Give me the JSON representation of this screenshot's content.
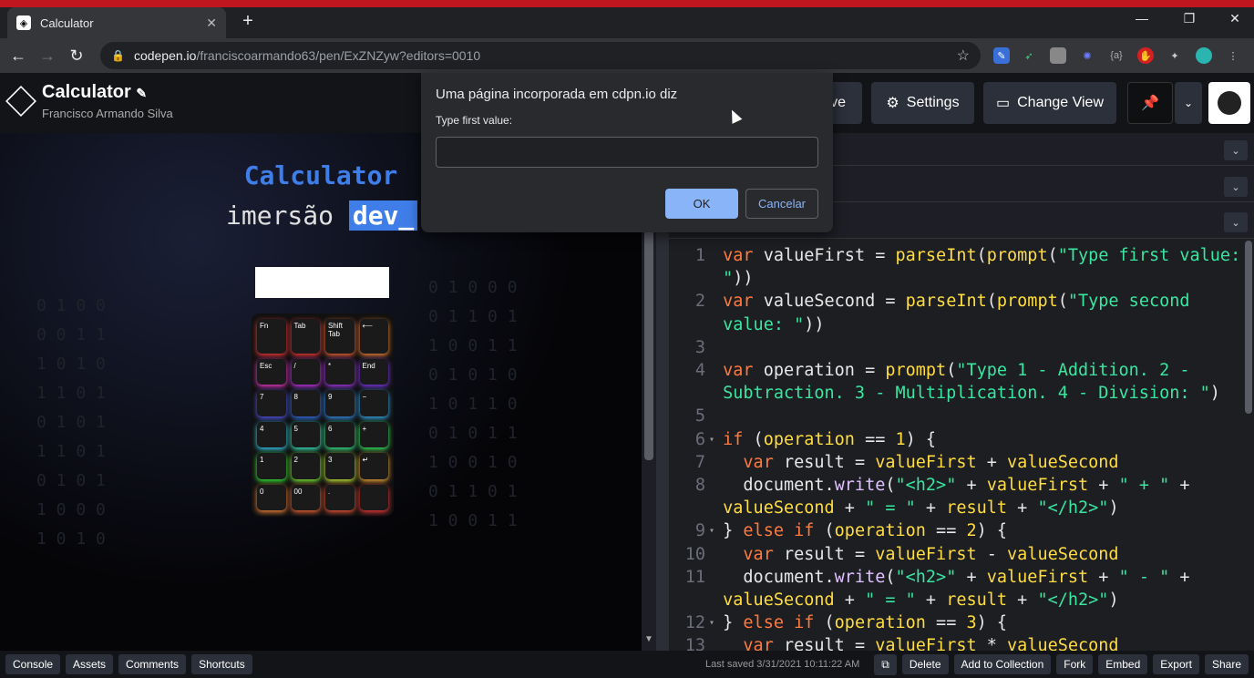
{
  "browser": {
    "tab_title": "Calculator",
    "url_host": "codepen.io",
    "url_path": "/franciscoarmando63/pen/ExZNZyw?editors=0010",
    "new_tab": "+",
    "close_tab": "✕",
    "win_min": "—",
    "win_max": "❐",
    "win_close": "✕"
  },
  "codepen": {
    "pen_title": "Calculator",
    "author": "Francisco Armando Silva",
    "save_label": "ve",
    "settings_label": "Settings",
    "change_view_label": "Change View"
  },
  "preview": {
    "title": "Calculator",
    "subtitle_plain": "imersão ",
    "subtitle_highlight": "dev_",
    "matrix_left": "0 1 0 0\n0 0 1 1\n1 0 1 0\n1 1 0 1\n0 1 0 1\n1 1 0 1\n0 1 0 1\n1 0 0 0\n1 0 1 0",
    "matrix_right": "0 1 0 0 0\n0 1 1 0 1\n1 0 0 1 1\n0 1 0 1 0\n1 0 1 1 0\n0 1 0 1 1\n1 0 0 1 0\n0 1 1 0 1\n1 0 0 1 1",
    "keys": [
      "Fn",
      "Tab",
      "Shift Tab",
      "⟵",
      "Esc",
      "/",
      "*",
      "End",
      "7",
      "8",
      "9",
      "−",
      "4",
      "5",
      "6",
      "+",
      "1",
      "2",
      "3",
      "↵",
      "0",
      "00",
      ".",
      ""
    ]
  },
  "dialog": {
    "title": "Uma página incorporada em cdpn.io diz",
    "label": "Type first value:",
    "input_value": "",
    "ok_label": "OK",
    "cancel_label": "Cancelar"
  },
  "code": {
    "lines": [
      {
        "n": "1",
        "fold": "",
        "html": "<span class='kw'>var</span> valueFirst = <span class='fn'>parseInt</span>(<span class='fn'>prompt</span>(<span class='str'>\"Type first value:</span>"
      },
      {
        "n": "",
        "fold": "",
        "html": "<span class='str'>\"</span>))"
      },
      {
        "n": "2",
        "fold": "",
        "html": "<span class='kw'>var</span> valueSecond = <span class='fn'>parseInt</span>(<span class='fn'>prompt</span>(<span class='str'>\"Type second</span>"
      },
      {
        "n": "",
        "fold": "",
        "html": "<span class='str'>value: \"</span>))"
      },
      {
        "n": "3",
        "fold": "",
        "html": ""
      },
      {
        "n": "4",
        "fold": "",
        "html": "<span class='kw'>var</span> operation = <span class='fn'>prompt</span>(<span class='str'>\"Type 1 - Addition. 2 -</span>"
      },
      {
        "n": "",
        "fold": "",
        "html": "<span class='str'>Subtraction. 3 - Multiplication. 4 - Division: \"</span>)"
      },
      {
        "n": "5",
        "fold": "",
        "html": ""
      },
      {
        "n": "6",
        "fold": "▾",
        "html": "<span class='kw'>if</span> (<span class='fn'>operation</span> == <span class='fn'>1</span>) {"
      },
      {
        "n": "7",
        "fold": "",
        "html": "  <span class='kw'>var</span> result = <span class='fn'>valueFirst</span> + <span class='fn'>valueSecond</span>"
      },
      {
        "n": "8",
        "fold": "",
        "html": "  document.<span class='vn'>write</span>(<span class='str'>\"&lt;h2&gt;\"</span> + <span class='fn'>valueFirst</span> + <span class='str'>\" + \"</span> +"
      },
      {
        "n": "",
        "fold": "",
        "html": "<span class='fn'>valueSecond</span> + <span class='str'>\" = \"</span> + <span class='fn'>result</span> + <span class='str'>\"&lt;/h2&gt;\"</span>)"
      },
      {
        "n": "9",
        "fold": "▾",
        "html": "} <span class='kw'>else if</span> (<span class='fn'>operation</span> == <span class='fn'>2</span>) {"
      },
      {
        "n": "10",
        "fold": "",
        "html": "  <span class='kw'>var</span> result = <span class='fn'>valueFirst</span> - <span class='fn'>valueSecond</span>"
      },
      {
        "n": "11",
        "fold": "",
        "html": "  document.<span class='vn'>write</span>(<span class='str'>\"&lt;h2&gt;\"</span> + <span class='fn'>valueFirst</span> + <span class='str'>\" - \"</span> +"
      },
      {
        "n": "",
        "fold": "",
        "html": "<span class='fn'>valueSecond</span> + <span class='str'>\" = \"</span> + <span class='fn'>result</span> + <span class='str'>\"&lt;/h2&gt;\"</span>)"
      },
      {
        "n": "12",
        "fold": "▾",
        "html": "} <span class='kw'>else if</span> (<span class='fn'>operation</span> == <span class='fn'>3</span>) {"
      },
      {
        "n": "13",
        "fold": "",
        "html": "  <span class='kw'>var</span> result = <span class='fn'>valueFirst</span> * <span class='fn'>valueSecond</span>"
      }
    ]
  },
  "footer": {
    "buttons_left": [
      "Console",
      "Assets",
      "Comments",
      "Shortcuts"
    ],
    "last_saved": "Last saved 3/31/2021 10:11:22 AM",
    "buttons_right": [
      "Delete",
      "Add to Collection",
      "Fork",
      "Embed",
      "Export",
      "Share"
    ]
  },
  "colors": {
    "accent": "#3f7de8",
    "dialog_ok": "#8ab4f8"
  }
}
